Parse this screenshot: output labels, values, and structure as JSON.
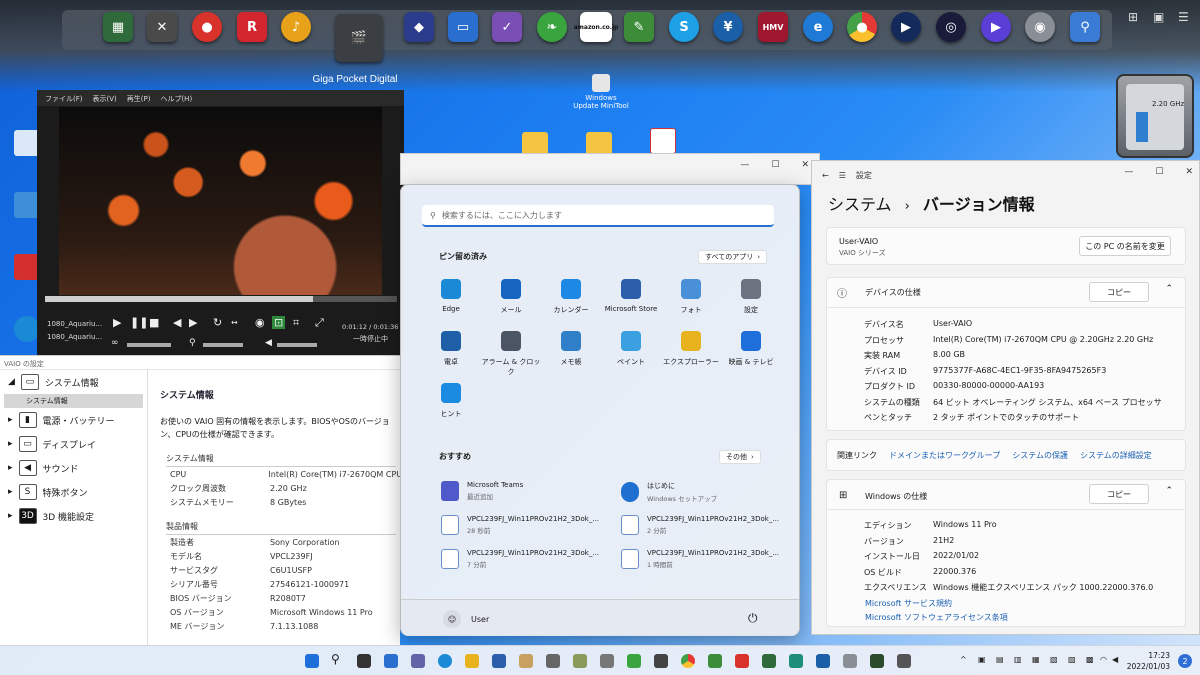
{
  "dock": {
    "label": "Giga Pocket Digital",
    "icons": [
      "app-grid-icon",
      "tools-icon",
      "media-disc-icon",
      "r-app-icon",
      "music-note-icon",
      "giga-pocket-icon",
      "photo-icon",
      "display-icon",
      "checklist-icon",
      "leaf-icon",
      "amazon-icon",
      "evernote-icon",
      "skype-icon",
      "yen-icon",
      "hmv-icon",
      "ie-icon",
      "chrome-icon",
      "media-player-icon",
      "circle-player-icon",
      "play-icon",
      "webcam-icon",
      "search-bot-icon"
    ],
    "amazon_text": "amazon.co.jp",
    "hmv_text": "HMV"
  },
  "desktop": {
    "windows_update_label": "Windows Update MiniTool",
    "cpu_freq": "2.20 GHz"
  },
  "player": {
    "menu": [
      "ファイル(F)",
      "表示(V)",
      "再生(P)",
      "ヘルプ(H)"
    ],
    "track1": "1080_Aquariu...",
    "track2": "1080_Aquariu...",
    "time": "0:01:12 / 0:01:36",
    "status": "一時停止中",
    "progress": 0.76
  },
  "vaio": {
    "title": "VAIO の設定",
    "nav": [
      {
        "label": "システム情報",
        "icon": "system-icon"
      },
      {
        "label": "電源・バッテリー",
        "icon": "battery-icon"
      },
      {
        "label": "ディスプレイ",
        "icon": "display-icon"
      },
      {
        "label": "サウンド",
        "icon": "speaker-icon"
      },
      {
        "label": "特殊ボタン",
        "icon": "special-button-icon"
      },
      {
        "label": "3D 機能設定",
        "icon": "3d-icon"
      }
    ],
    "nav_sub": "システム情報",
    "heading": "システム情報",
    "description": "お使いの VAIO 固有の情報を表示します。BIOSやOSのバージョン、CPUの仕様が確認できます。",
    "sysinfo_header": "システム情報",
    "sysinfo": [
      {
        "k": "CPU",
        "v": "Intel(R) Core(TM) i7-2670QM CPU"
      },
      {
        "k": "クロック周波数",
        "v": "2.20 GHz"
      },
      {
        "k": "システムメモリー",
        "v": "8 GBytes"
      }
    ],
    "product_header": "製品情報",
    "product": [
      {
        "k": "製造者",
        "v": "Sony Corporation"
      },
      {
        "k": "モデル名",
        "v": "VPCL239FJ"
      },
      {
        "k": "サービスタグ",
        "v": "C6U1USFP"
      },
      {
        "k": "シリアル番号",
        "v": "27546121-1000971"
      },
      {
        "k": "BIOS バージョン",
        "v": "R2080T7"
      },
      {
        "k": "OS バージョン",
        "v": "Microsoft Windows 11 Pro"
      },
      {
        "k": "ME バージョン",
        "v": "7.1.13.1088"
      }
    ]
  },
  "start": {
    "search_placeholder": "検索するには、ここに入力します",
    "pinned_title": "ピン留め済み",
    "all_apps": "すべてのアプリ",
    "pinned": [
      {
        "label": "Edge",
        "color": "#1b8ad6"
      },
      {
        "label": "メール",
        "color": "#1565c0"
      },
      {
        "label": "カレンダー",
        "color": "#1e88e5"
      },
      {
        "label": "Microsoft Store",
        "color": "#2b5fab"
      },
      {
        "label": "フォト",
        "color": "#4a90d9"
      },
      {
        "label": "設定",
        "color": "#6b7280"
      },
      {
        "label": "電卓",
        "color": "#1f5fa8"
      },
      {
        "label": "アラーム & クロック",
        "color": "#4b5563"
      },
      {
        "label": "メモ帳",
        "color": "#2f80c9"
      },
      {
        "label": "ペイント",
        "color": "#3aa0e0"
      },
      {
        "label": "エクスプローラー",
        "color": "#e8b21c"
      },
      {
        "label": "映画 & テレビ",
        "color": "#1e6fd9"
      },
      {
        "label": "ヒント",
        "color": "#1a8be0"
      }
    ],
    "recommended_title": "おすすめ",
    "more": "その他",
    "recommended": [
      {
        "t1": "Microsoft Teams",
        "t2": "最近追加"
      },
      {
        "t1": "はじめに",
        "t2": "Windows セットアップ"
      },
      {
        "t1": "VPCL239FJ_Win11PROv21H2_3Dok_...",
        "t2": "28 秒前"
      },
      {
        "t1": "VPCL239FJ_Win11PROv21H2_3Dok_...",
        "t2": "2 分前"
      },
      {
        "t1": "VPCL239FJ_Win11PROv21H2_3Dok_...",
        "t2": "7 分前"
      },
      {
        "t1": "VPCL239FJ_Win11PROv21H2_3Dok_...",
        "t2": "1 時間前"
      }
    ],
    "user": "User"
  },
  "settings": {
    "app_title": "設定",
    "breadcrumb_parent": "システム",
    "breadcrumb_sep": "›",
    "breadcrumb_current": "バージョン情報",
    "pc_name": "User-VAIO",
    "pc_series": "VAIO シリーズ",
    "rename_button": "この PC の名前を変更",
    "device_spec_title": "デバイスの仕様",
    "copy": "コピー",
    "device_spec": [
      {
        "k": "デバイス名",
        "v": "User-VAIO"
      },
      {
        "k": "プロセッサ",
        "v": "Intel(R) Core(TM) i7-2670QM CPU @ 2.20GHz   2.20 GHz"
      },
      {
        "k": "実装 RAM",
        "v": "8.00 GB"
      },
      {
        "k": "デバイス ID",
        "v": "9775377F-A68C-4EC1-9F35-8FA9475265F3"
      },
      {
        "k": "プロダクト ID",
        "v": "00330-80000-00000-AA193"
      },
      {
        "k": "システムの種類",
        "v": "64 ビット オペレーティング システム、x64 ベース プロセッサ"
      },
      {
        "k": "ペンとタッチ",
        "v": "2 タッチ ポイントでのタッチのサポート"
      }
    ],
    "related_label": "関連リンク",
    "related": [
      "ドメインまたはワークグループ",
      "システムの保護",
      "システムの詳細設定"
    ],
    "windows_spec_title": "Windows の仕様",
    "windows_spec": [
      {
        "k": "エディション",
        "v": "Windows 11 Pro"
      },
      {
        "k": "バージョン",
        "v": "21H2"
      },
      {
        "k": "インストール日",
        "v": "2022/01/02"
      },
      {
        "k": "OS ビルド",
        "v": "22000.376"
      },
      {
        "k": "エクスペリエンス",
        "v": "Windows 機能エクスペリエンス パック 1000.22000.376.0"
      }
    ],
    "link1": "Microsoft サービス規約",
    "link2": "Microsoft ソフトウェアライセンス条項"
  },
  "taskbar": {
    "time": "17:23",
    "date": "2022/01/03",
    "notifications": "2",
    "tray_chevron": "^"
  },
  "colors": {
    "accent": "#2a6fcf",
    "link": "#1a5fb4",
    "wallpaper": "#1b7cf0"
  }
}
